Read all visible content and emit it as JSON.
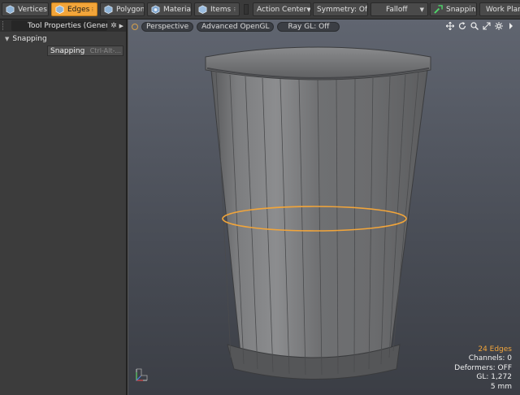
{
  "toolbar": {
    "vertices": "Vertices",
    "edges": "Edges",
    "polygons": "Polygons",
    "materials": "Materials",
    "items": "Items",
    "action_center": "Action Center",
    "symmetry": "Symmetry: Off",
    "falloff": "Falloff",
    "snapping": "Snapping",
    "work_plane": "Work Plane",
    "accent": "#f2a53a"
  },
  "left_panel": {
    "tab_title": "Tool Properties (General)",
    "section": "Snapping",
    "field_label": "Snapping",
    "field_shortcut": "Ctrl-Alt-..."
  },
  "viewport": {
    "view_mode": "Perspective",
    "renderer": "Advanced OpenGL",
    "raygl": "Ray GL: Off",
    "icons": [
      "move-icon",
      "rotate-icon",
      "zoom-icon",
      "maximize-icon",
      "settings-icon",
      "chevron-right-icon"
    ],
    "info": {
      "selection": "24 Edges",
      "channels": "Channels: 0",
      "deformers": "Deformers: OFF",
      "gl": "GL: 1,272",
      "scale": "5 mm"
    },
    "selection_color": "#f2a53a"
  }
}
